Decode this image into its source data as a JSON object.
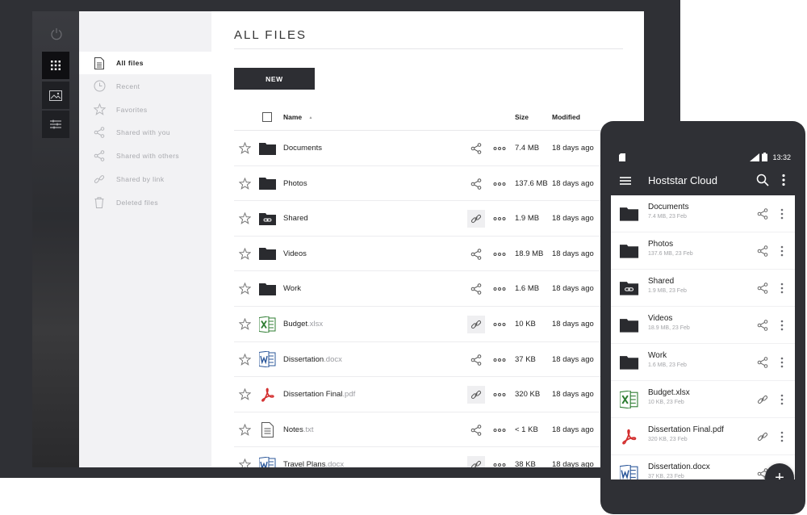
{
  "sidebar": {
    "items": [
      {
        "label": "All files",
        "icon": "document-icon",
        "active": true
      },
      {
        "label": "Recent",
        "icon": "clock-icon",
        "active": false
      },
      {
        "label": "Favorites",
        "icon": "star-icon",
        "active": false
      },
      {
        "label": "Shared with you",
        "icon": "share-icon",
        "active": false
      },
      {
        "label": "Shared with others",
        "icon": "share-icon",
        "active": false
      },
      {
        "label": "Shared by link",
        "icon": "link-icon",
        "active": false
      },
      {
        "label": "Deleted files",
        "icon": "trash-icon",
        "active": false
      }
    ]
  },
  "main": {
    "title": "ALL FILES",
    "new_button": "NEW",
    "columns": {
      "name": "Name",
      "size": "Size",
      "modified": "Modified"
    },
    "sort_indicator": "▲"
  },
  "files": [
    {
      "name": "Documents",
      "ext": "",
      "type": "folder",
      "share": "share",
      "size": "7.4 MB",
      "modified": "18 days ago"
    },
    {
      "name": "Photos",
      "ext": "",
      "type": "folder",
      "share": "share",
      "size": "137.6 MB",
      "modified": "18 days ago"
    },
    {
      "name": "Shared",
      "ext": "",
      "type": "folder-link",
      "share": "link",
      "size": "1.9 MB",
      "modified": "18 days ago"
    },
    {
      "name": "Videos",
      "ext": "",
      "type": "folder",
      "share": "share",
      "size": "18.9 MB",
      "modified": "18 days ago"
    },
    {
      "name": "Work",
      "ext": "",
      "type": "folder",
      "share": "share",
      "size": "1.6 MB",
      "modified": "18 days ago"
    },
    {
      "name": "Budget",
      "ext": ".xlsx",
      "type": "excel",
      "share": "link",
      "size": "10 KB",
      "modified": "18 days ago"
    },
    {
      "name": "Dissertation",
      "ext": ".docx",
      "type": "word",
      "share": "share",
      "size": "37 KB",
      "modified": "18 days ago"
    },
    {
      "name": "Dissertation Final",
      "ext": ".pdf",
      "type": "pdf",
      "share": "link",
      "size": "320 KB",
      "modified": "18 days ago"
    },
    {
      "name": "Notes",
      "ext": ".txt",
      "type": "text",
      "share": "share",
      "size": "< 1 KB",
      "modified": "18 days ago"
    },
    {
      "name": "Travel Plans",
      "ext": ".docx",
      "type": "word",
      "share": "link",
      "size": "38 KB",
      "modified": "18 days ago"
    }
  ],
  "phone": {
    "time": "13:32",
    "app_title": "Hoststar Cloud",
    "fab_label": "+",
    "files": [
      {
        "name": "Documents",
        "meta": "7.4 MB,  23 Feb",
        "type": "folder",
        "share": "share"
      },
      {
        "name": "Photos",
        "meta": "137.6 MB,  23 Feb",
        "type": "folder",
        "share": "share"
      },
      {
        "name": "Shared",
        "meta": "1.9 MB,  23 Feb",
        "type": "folder-link",
        "share": "share"
      },
      {
        "name": "Videos",
        "meta": "18.9 MB,  23 Feb",
        "type": "folder",
        "share": "share"
      },
      {
        "name": "Work",
        "meta": "1.6 MB,  23 Feb",
        "type": "folder",
        "share": "share"
      },
      {
        "name": "Budget.xlsx",
        "meta": "10 KB,  23 Feb",
        "type": "excel",
        "share": "link"
      },
      {
        "name": "Dissertation Final.pdf",
        "meta": "320 KB,  23 Feb",
        "type": "pdf",
        "share": "link"
      },
      {
        "name": "Dissertation.docx",
        "meta": "37 KB,  23 Feb",
        "type": "word",
        "share": "share"
      }
    ]
  },
  "colors": {
    "dark": "#2f3035",
    "excel": "#2e7d32",
    "word": "#2b579a",
    "pdf": "#d32f2f",
    "muted": "#a8a9ae"
  }
}
